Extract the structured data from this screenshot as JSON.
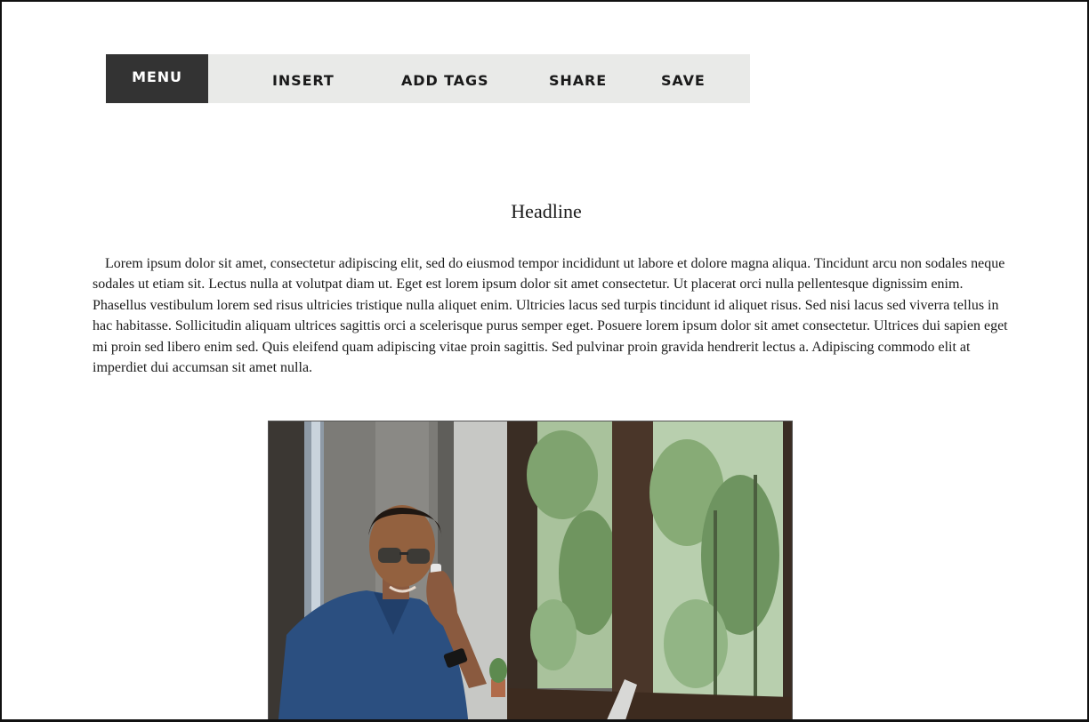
{
  "toolbar": {
    "menu_label": "MENU",
    "insert_label": "INSERT",
    "add_tags_label": "ADD TAGS",
    "share_label": "SHARE",
    "save_label": "SAVE"
  },
  "article": {
    "headline": "Headline",
    "body": "Lorem ipsum dolor sit amet, consectetur adipiscing elit, sed do eiusmod tempor incididunt ut labore et dolore magna aliqua. Tincidunt arcu non sodales neque sodales ut etiam sit. Lectus nulla at volutpat diam ut. Eget est lorem ipsum dolor sit amet consectetur. Ut placerat orci nulla pellentesque dignissim enim. Phasellus vestibulum lorem sed risus ultricies tristique nulla aliquet enim. Ultricies lacus sed turpis tincidunt id aliquet risus. Sed nisi lacus sed viverra tellus in hac habitasse. Sollicitudin aliquam ultrices sagittis orci a scelerisque purus semper eget. Posuere lorem ipsum dolor sit amet consectetur. Ultrices dui sapien eget mi proin sed libero enim sed. Quis eleifend quam adipiscing vitae proin sagittis. Sed pulvinar proin gravida hendrerit lectus a. Adipiscing commodo elit at imperdiet dui accumsan sit amet nulla."
  },
  "colors": {
    "toolbar_bg": "#e9eae8",
    "menu_bg": "#333333",
    "text": "#1a1a1a"
  }
}
